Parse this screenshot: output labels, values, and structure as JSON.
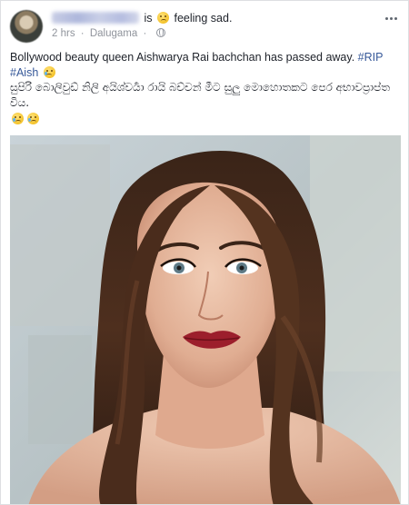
{
  "post": {
    "author_action": "is",
    "feeling_label": "feeling sad.",
    "timestamp": "2 hrs",
    "location": "Dalugama",
    "meta_separator": "·",
    "text_line1": "Bollywood beauty queen Aishwarya Rai bachchan has passed away.",
    "hashtag_rip": "#RIP",
    "hashtag_aish": "#Aish",
    "text_sinhala": "සුපිරි බොලිවුඩ් නිලි අයිශ්වර්‍යා රායි බච්චන් මීට සුලු මොහොතකට පෙර අභාවප්‍රාප්ත විය.",
    "icons": {
      "avatar": "profile-picture",
      "feeling": "sad-face-emoji",
      "privacy": "globe-icon",
      "more": "more-options-icon",
      "crying": "crying-face-emoji"
    },
    "colors": {
      "link": "#365899",
      "meta": "#90949c",
      "text": "#1d2129"
    }
  }
}
